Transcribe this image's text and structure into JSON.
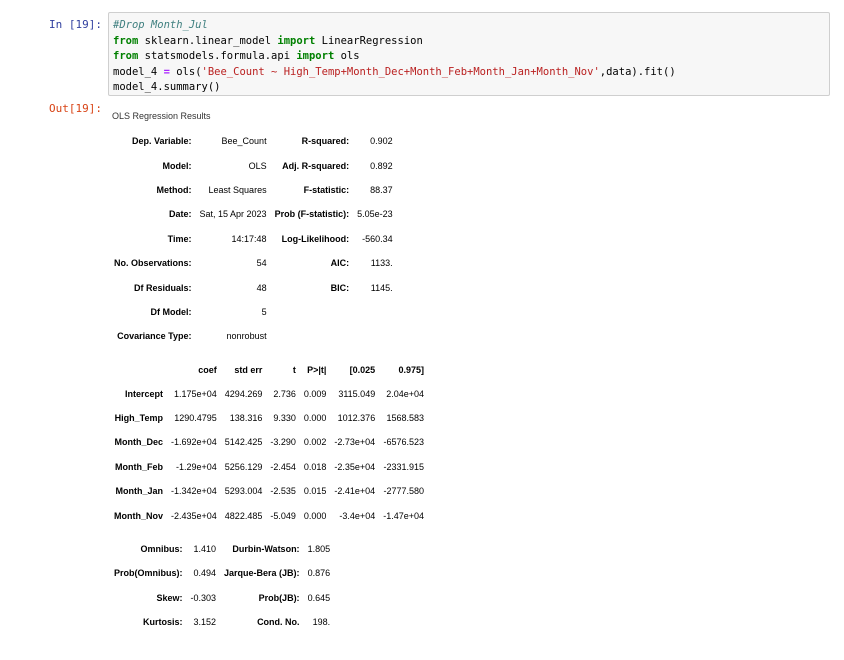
{
  "cell": {
    "in_prompt": "In [19]:",
    "out_prompt": "Out[19]:",
    "code": {
      "comment": "#Drop Month_Jul",
      "line2": {
        "kw1": "from",
        "mod": " sklearn.linear_model ",
        "kw2": "import",
        "name": " LinearRegression"
      },
      "line3": {
        "kw1": "from",
        "mod": " statsmodels.formula.api ",
        "kw2": "import",
        "name": " ols"
      },
      "line4": {
        "pre": "model_4 ",
        "eq": "=",
        "call": " ols(",
        "formula": "'Bee_Count ~ High_Temp+Month_Dec+Month_Feb+Month_Jan+Month_Nov'",
        "post": ",data).fit()"
      },
      "line5": "model_4.summary()"
    }
  },
  "summary": {
    "caption": "OLS Regression Results",
    "top_table": [
      [
        "Dep. Variable:",
        "Bee_Count",
        "R-squared:",
        "0.902"
      ],
      [
        "Model:",
        "OLS",
        "Adj. R-squared:",
        "0.892"
      ],
      [
        "Method:",
        "Least Squares",
        "F-statistic:",
        "88.37"
      ],
      [
        "Date:",
        "Sat, 15 Apr 2023",
        "Prob (F-statistic):",
        "5.05e-23"
      ],
      [
        "Time:",
        "14:17:48",
        "Log-Likelihood:",
        "-560.34"
      ],
      [
        "No. Observations:",
        "54",
        "AIC:",
        "1133."
      ],
      [
        "Df Residuals:",
        "48",
        "BIC:",
        "1145."
      ],
      [
        "Df Model:",
        "5",
        "",
        ""
      ],
      [
        "Covariance Type:",
        "nonrobust",
        "",
        ""
      ]
    ],
    "coef_headers": [
      "",
      "coef",
      "std err",
      "t",
      "P>|t|",
      "[0.025",
      "0.975]"
    ],
    "coef_rows": [
      [
        "Intercept",
        "1.175e+04",
        "4294.269",
        "2.736",
        "0.009",
        "3115.049",
        "2.04e+04"
      ],
      [
        "High_Temp",
        "1290.4795",
        "138.316",
        "9.330",
        "0.000",
        "1012.376",
        "1568.583"
      ],
      [
        "Month_Dec",
        "-1.692e+04",
        "5142.425",
        "-3.290",
        "0.002",
        "-2.73e+04",
        "-6576.523"
      ],
      [
        "Month_Feb",
        "-1.29e+04",
        "5256.129",
        "-2.454",
        "0.018",
        "-2.35e+04",
        "-2331.915"
      ],
      [
        "Month_Jan",
        "-1.342e+04",
        "5293.004",
        "-2.535",
        "0.015",
        "-2.41e+04",
        "-2777.580"
      ],
      [
        "Month_Nov",
        "-2.435e+04",
        "4822.485",
        "-5.049",
        "0.000",
        "-3.4e+04",
        "-1.47e+04"
      ]
    ],
    "diag_table": [
      [
        "Omnibus:",
        "1.410",
        "Durbin-Watson:",
        "1.805"
      ],
      [
        "Prob(Omnibus):",
        "0.494",
        "Jarque-Bera (JB):",
        "0.876"
      ],
      [
        "Skew:",
        "-0.303",
        "Prob(JB):",
        "0.645"
      ],
      [
        "Kurtosis:",
        "3.152",
        "Cond. No.",
        "198."
      ]
    ]
  }
}
